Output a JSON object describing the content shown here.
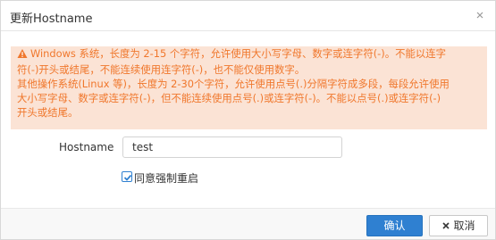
{
  "dialog": {
    "title": "更新Hostname"
  },
  "alert": {
    "lines": [
      "Windows 系统，长度为 2-15 个字符，允许使用大小写字母、数字或连字符(-)。不能以连字",
      "符(-)开头或结尾，不能连续使用连字符(-)，也不能仅使用数字。",
      "其他操作系统(Linux 等)，长度为 2-30个字符，允许使用点号(.)分隔字符成多段，每段允许使用",
      "大小写字母、数字或连字符(-)，但不能连续使用点号(.)或连字符(-)。不能以点号(.)或连字符(-)",
      "开头或结尾。"
    ],
    "color": "#f0772c",
    "background": "#fbe3d5",
    "icon": "warning-icon"
  },
  "form": {
    "hostname_label": "Hostname",
    "hostname_value": "test",
    "force_restart_label": "同意强制重启",
    "force_restart_checked": true
  },
  "footer": {
    "confirm_label": "确认",
    "cancel_label": "取消",
    "confirm_color": "#2f80d1"
  }
}
